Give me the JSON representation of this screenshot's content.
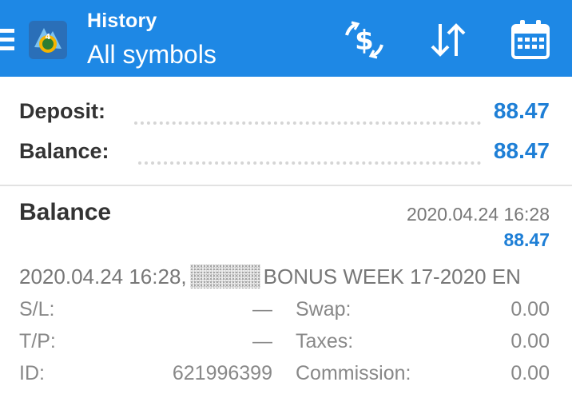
{
  "header": {
    "title": "History",
    "subtitle": "All symbols",
    "icons": [
      "menu-icon",
      "metatrader-logo",
      "currency-exchange-icon",
      "sort-icon",
      "calendar-icon"
    ],
    "accent_color": "#1e88e5"
  },
  "summary": {
    "deposit_label": "Deposit:",
    "deposit_value": "88.47",
    "balance_label": "Balance:",
    "balance_value": "88.47"
  },
  "deal": {
    "type": "Balance",
    "time": "2020.04.24 16:28",
    "amount": "88.47",
    "comment_time": "2020.04.24 16:28,",
    "comment_text": "BONUS WEEK 17-2020 EN",
    "sl_label": "S/L:",
    "sl_value": "—",
    "tp_label": "T/P:",
    "tp_value": "—",
    "id_label": "ID:",
    "id_value": "621996399",
    "swap_label": "Swap:",
    "swap_value": "0.00",
    "taxes_label": "Taxes:",
    "taxes_value": "0.00",
    "commission_label": "Commission:",
    "commission_value": "0.00"
  }
}
